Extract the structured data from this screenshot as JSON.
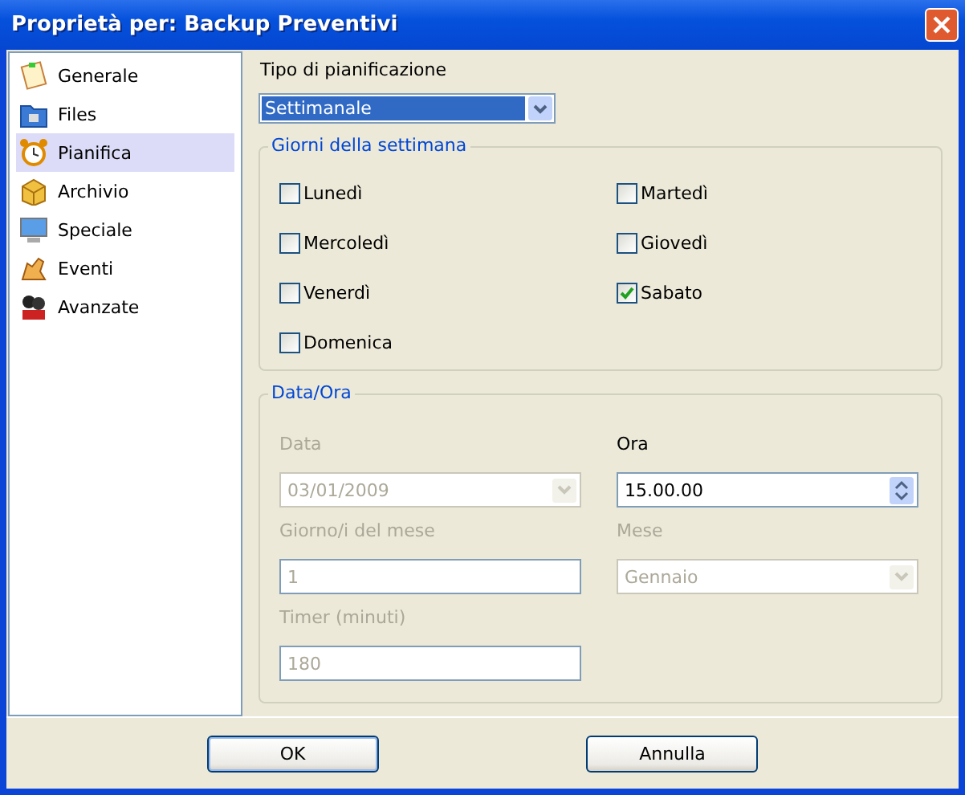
{
  "window": {
    "title": "Proprietà per: Backup Preventivi"
  },
  "sidebar": {
    "items": [
      {
        "label": "Generale",
        "selected": false
      },
      {
        "label": "Files",
        "selected": false
      },
      {
        "label": "Pianifica",
        "selected": true
      },
      {
        "label": "Archivio",
        "selected": false
      },
      {
        "label": "Speciale",
        "selected": false
      },
      {
        "label": "Eventi",
        "selected": false
      },
      {
        "label": "Avanzate",
        "selected": false
      }
    ]
  },
  "schedule_type": {
    "label": "Tipo di pianificazione",
    "value": "Settimanale"
  },
  "weekdays": {
    "title": "Giorni della settimana",
    "days": [
      {
        "label": "Lunedì",
        "checked": false
      },
      {
        "label": "Martedì",
        "checked": false
      },
      {
        "label": "Mercoledì",
        "checked": false
      },
      {
        "label": "Giovedì",
        "checked": false
      },
      {
        "label": "Venerdì",
        "checked": false
      },
      {
        "label": "Sabato",
        "checked": true
      },
      {
        "label": "Domenica",
        "checked": false
      }
    ]
  },
  "datetime": {
    "title": "Data/Ora",
    "fields": [
      {
        "label": "Data",
        "value": "03/01/2009",
        "kind": "combo",
        "disabled": true
      },
      {
        "label": "Ora",
        "value": "15.00.00",
        "kind": "spin",
        "disabled": false
      },
      {
        "label": "Giorno/i del mese",
        "value": "1",
        "kind": "text",
        "disabled": true
      },
      {
        "label": "Mese",
        "value": "Gennaio",
        "kind": "combo",
        "disabled": true
      },
      {
        "label": "Timer (minuti)",
        "value": "180",
        "kind": "text",
        "disabled": true
      }
    ]
  },
  "buttons": [
    {
      "label": "OK",
      "default": true
    },
    {
      "label": "Annulla",
      "default": false
    }
  ]
}
